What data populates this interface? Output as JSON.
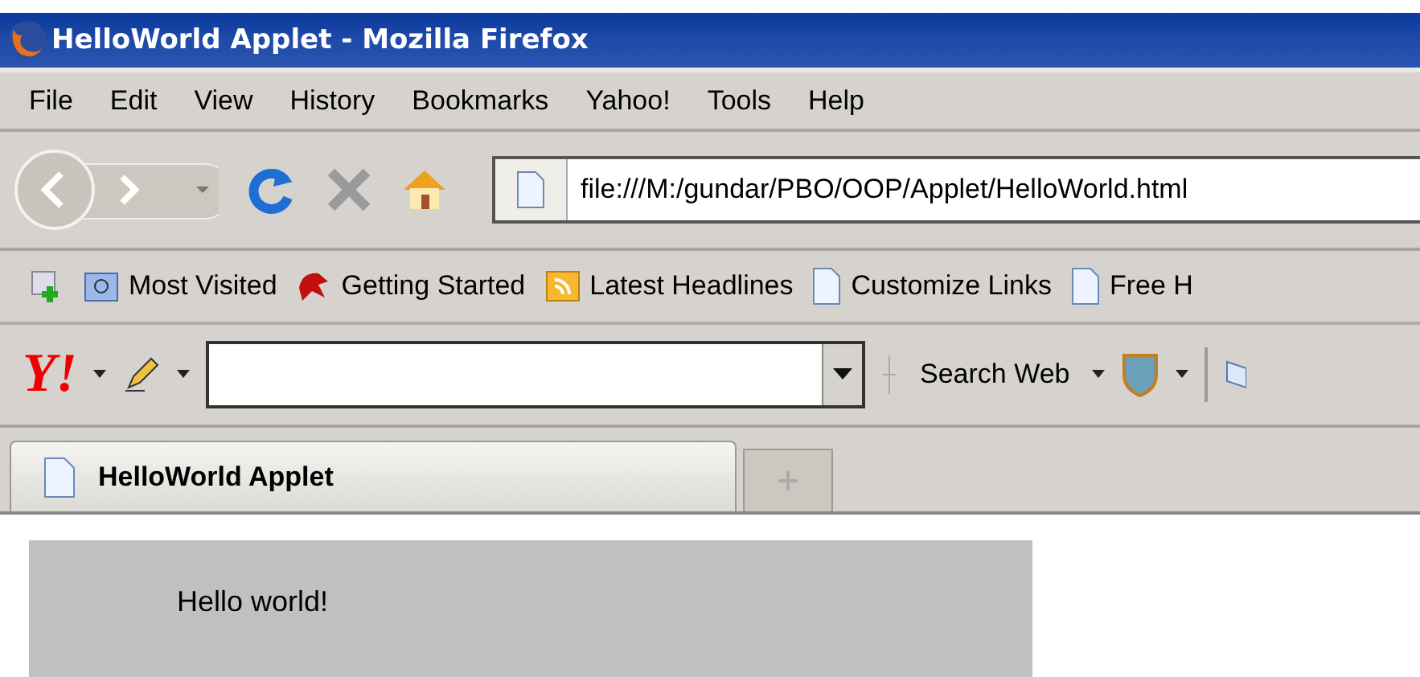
{
  "window": {
    "title": "HelloWorld Applet - Mozilla Firefox"
  },
  "menu": [
    "File",
    "Edit",
    "View",
    "History",
    "Bookmarks",
    "Yahoo!",
    "Tools",
    "Help"
  ],
  "address": {
    "value": "file:///M:/gundar/PBO/OOP/Applet/HelloWorld.html"
  },
  "bookmarks": [
    {
      "label": "Most Visited",
      "kind": "folder"
    },
    {
      "label": "Getting Started",
      "kind": "dragon"
    },
    {
      "label": "Latest Headlines",
      "kind": "feed"
    },
    {
      "label": "Customize Links",
      "kind": "page"
    },
    {
      "label": "Free H",
      "kind": "page"
    }
  ],
  "yahoo_toolbar": {
    "logo": "Y!",
    "search_label": "Search Web"
  },
  "tabs": [
    {
      "label": "HelloWorld Applet",
      "selected": true
    }
  ],
  "applet": {
    "text": "Hello world!"
  }
}
